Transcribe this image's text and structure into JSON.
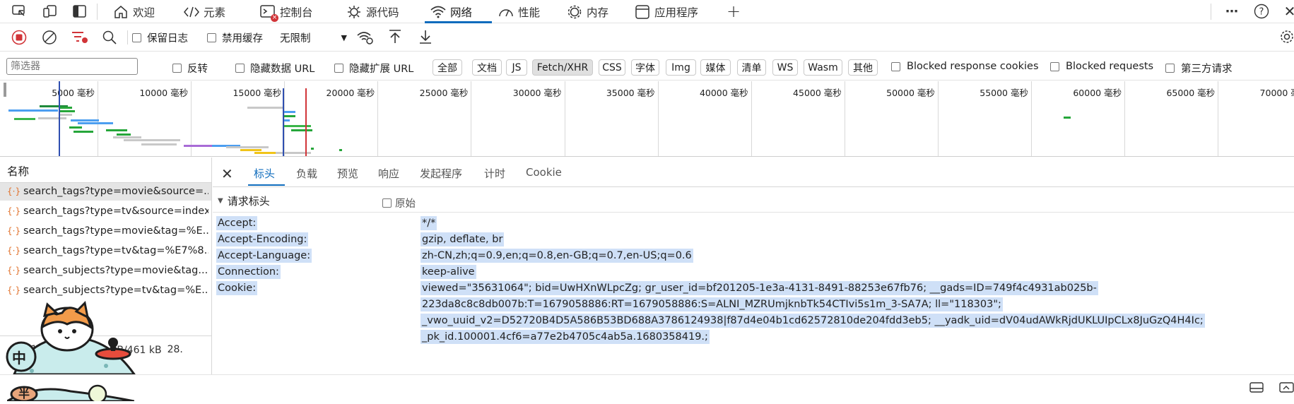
{
  "top_tabs": [
    {
      "label": "欢迎",
      "icon": "home-icon"
    },
    {
      "label": "元素",
      "icon": "code-icon"
    },
    {
      "label": "控制台",
      "icon": "console-icon"
    },
    {
      "label": "源代码",
      "icon": "bug-icon"
    },
    {
      "label": "网络",
      "icon": "wifi-icon",
      "active": true
    },
    {
      "label": "性能",
      "icon": "gauge-icon"
    },
    {
      "label": "内存",
      "icon": "memory-icon"
    },
    {
      "label": "应用程序",
      "icon": "app-icon"
    }
  ],
  "toolbar": {
    "preserve_log": "保留日志",
    "disable_cache": "禁用缓存",
    "throttle_value": "无限制"
  },
  "filterbar": {
    "placeholder": "筛选器",
    "invert": "反转",
    "hide_data_url": "隐藏数据 URL",
    "hide_ext_url": "隐藏扩展 URL",
    "types": [
      "全部",
      "文档",
      "JS",
      "Fetch/XHR",
      "CSS",
      "字体",
      "Img",
      "媒体",
      "清单",
      "WS",
      "Wasm",
      "其他"
    ],
    "selected_type": "Fetch/XHR",
    "blocked_cookies": "Blocked response cookies",
    "blocked_requests": "Blocked requests",
    "third_party": "第三方请求"
  },
  "overview": {
    "ticks": [
      "5000 毫秒",
      "10000 毫秒",
      "15000 毫秒",
      "20000 毫秒",
      "25000 毫秒",
      "30000 毫秒",
      "35000 毫秒",
      "40000 毫秒",
      "45000 毫秒",
      "50000 毫秒",
      "55000 毫秒",
      "60000 毫秒",
      "65000 毫秒",
      "70000 毫秒"
    ]
  },
  "requests": {
    "column_header": "名称",
    "items": [
      "search_tags?type=movie&source=...",
      "search_tags?type=tv&source=index",
      "search_tags?type=movie&tag=%E...",
      "search_tags?type=tv&tag=%E7%8...",
      "search_subjects?type=movie&tag...",
      "search_subjects?type=tv&tag=%E..."
    ],
    "summary_left": "/21",
    "summary_transfer": "传输8.9 kB/461 kB",
    "summary_right": "28."
  },
  "details": {
    "tabs": [
      "标头",
      "负载",
      "预览",
      "响应",
      "发起程序",
      "计时",
      "Cookie"
    ],
    "active_tab": "标头",
    "section_title": "请求标头",
    "raw_label": "原始",
    "headers": [
      {
        "name": "Accept:",
        "value": [
          "*/*"
        ]
      },
      {
        "name": "Accept-Encoding:",
        "value": [
          "gzip, deflate, br"
        ]
      },
      {
        "name": "Accept-Language:",
        "value": [
          "zh-CN,zh;q=0.9,en;q=0.8,en-GB;q=0.7,en-US;q=0.6"
        ]
      },
      {
        "name": "Connection:",
        "value": [
          "keep-alive"
        ]
      },
      {
        "name": "Cookie:",
        "value": [
          "viewed=\"35631064\"; bid=UwHXnWLpcZg; gr_user_id=bf201205-1e3a-4131-8491-88253e67fb76; __gads=ID=749f4c4931ab025b-",
          "223da8c8c8db007b:T=1679058886:RT=1679058886:S=ALNI_MZRUmjknbTk54CTIvi5s1m_3-SA7A; ll=\"118303\";",
          "_vwo_uuid_v2=D52720B4D5A586B53BD688A3786124938|f87d4e04b1cd62572810de204fdd3eb5; __yadk_uid=dV04udAWkRjdUKLUIpCLx8JuGzQ4H4Ic;",
          "_pk_id.100001.4cf6=a77e2b4705c4ab5a.1680358419.;"
        ]
      }
    ]
  },
  "mascot": {
    "badge_zh": "中",
    "badge_ban": "半"
  },
  "colors": {
    "accent": "#0f6cbd",
    "record_red": "#d13438",
    "selection": "#cfe0f7"
  }
}
